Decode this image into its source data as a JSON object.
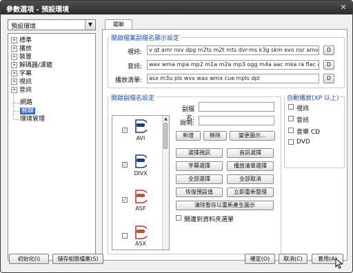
{
  "window": {
    "title": "參數選項 - 預設環境"
  },
  "profile": {
    "selected": "預設環境"
  },
  "tree": {
    "items": [
      {
        "label": "標準",
        "expander": "+"
      },
      {
        "label": "播放",
        "expander": "+"
      },
      {
        "label": "裝置",
        "expander": "+"
      },
      {
        "label": "解碼器/濾鏡",
        "expander": "+"
      },
      {
        "label": "字幕",
        "expander": "+"
      },
      {
        "label": "視訊",
        "expander": "+"
      },
      {
        "label": "音訊",
        "expander": "+"
      },
      {
        "label": "網路",
        "expander": ""
      },
      {
        "label": "關聯",
        "expander": ""
      },
      {
        "label": "環境管理",
        "expander": ""
      }
    ]
  },
  "tab": {
    "label": "關聯"
  },
  "ext_group": {
    "title": "開啟檔案副檔名顯示設定",
    "video_label": "視訊:",
    "video_value": "v qt amr nsv dpg m2ts m2t mts dvr-ms k3g skm evo nsr amv divx",
    "audio_label": "音訊:",
    "audio_value": "wav wma mpa mp2 m1a m2a mp3 ogg m4a aac mka ra flac ape",
    "playlist_label": "播放清單:",
    "playlist_value": "asx m3u pls wvx wax wmx cue mpls dpl",
    "d_label": "D"
  },
  "assoc_group": {
    "title": "開啟副檔名設定",
    "items": [
      {
        "name": "AVI",
        "checked": true,
        "check": "✓"
      },
      {
        "name": "DIVX",
        "checked": true,
        "check": "✓"
      },
      {
        "name": "ASF",
        "checked": true,
        "check": "✓"
      },
      {
        "name": "ASX",
        "checked": false,
        "check": ""
      }
    ],
    "ext_label": "副檔名:",
    "desc_label": "說明:",
    "add": "新增",
    "remove": "移除",
    "change_icon": "變更圖示...",
    "select_video": "選擇視訊",
    "select_audio": "音訊選擇",
    "select_subtitle": "字幕選擇",
    "select_playlist": "播放清單選擇",
    "select_all": "全部選擇",
    "cancel_all": "全部取消",
    "restore_default": "恢復預設值",
    "apply_now": "立即重新整理",
    "clear_cache": "清除暫存以重新產生圖示",
    "context_menu": "關連到資料夾選單"
  },
  "autoplay": {
    "title": "自動播放(XP 以上)",
    "items": [
      "視訊",
      "音訊",
      "音樂 CD",
      "DVD"
    ]
  },
  "buttons": {
    "init": "初始化(I)",
    "save_config": "儲存組態檔案(S)",
    "ok": "確定(O)",
    "cancel": "取消(C)",
    "apply": "套用(A)"
  },
  "colors": {
    "accent": "#1b4fb3",
    "selection": "#3068c8",
    "titlebar": "#2b2b2b"
  }
}
